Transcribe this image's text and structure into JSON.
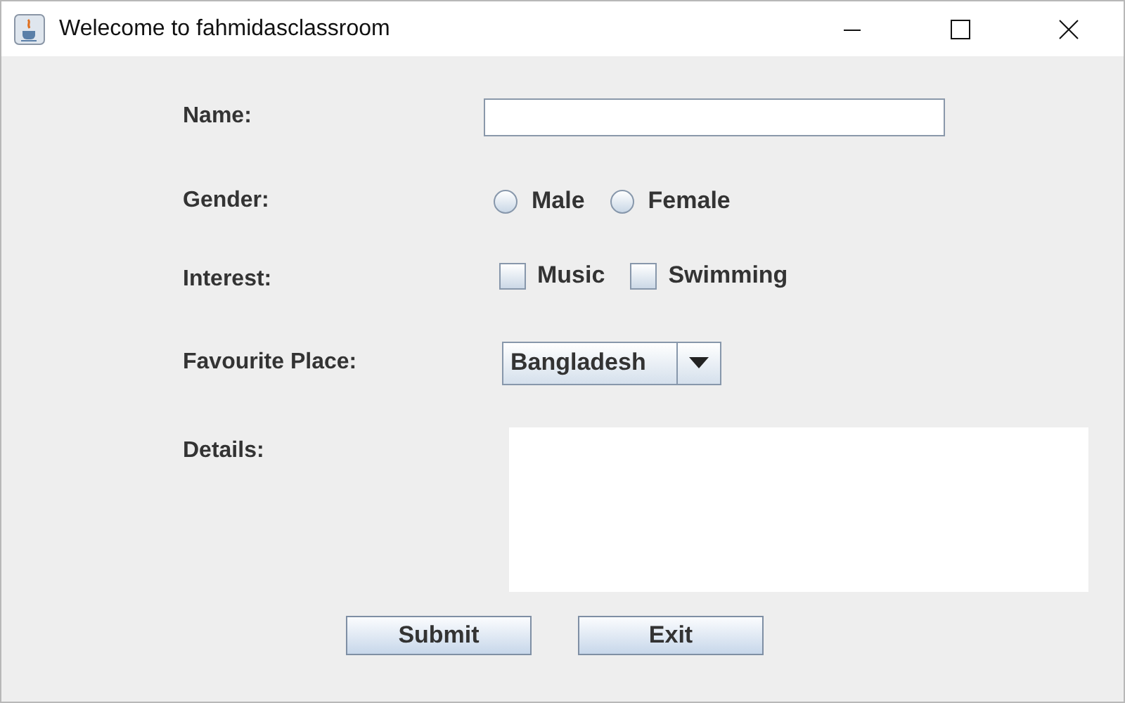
{
  "window": {
    "title": "Welecome to fahmidasclassroom"
  },
  "form": {
    "name": {
      "label": "Name:"
    },
    "gender": {
      "label": "Gender:",
      "options": [
        {
          "label": "Male",
          "selected": false
        },
        {
          "label": "Female",
          "selected": false
        }
      ]
    },
    "interest": {
      "label": "Interest:",
      "options": [
        {
          "label": "Music",
          "checked": false
        },
        {
          "label": "Swimming",
          "checked": false
        }
      ]
    },
    "place": {
      "label": "Favourite Place:",
      "value": "Bangladesh"
    },
    "details": {
      "label": "Details:"
    }
  },
  "buttons": [
    "Submit",
    "Exit"
  ]
}
